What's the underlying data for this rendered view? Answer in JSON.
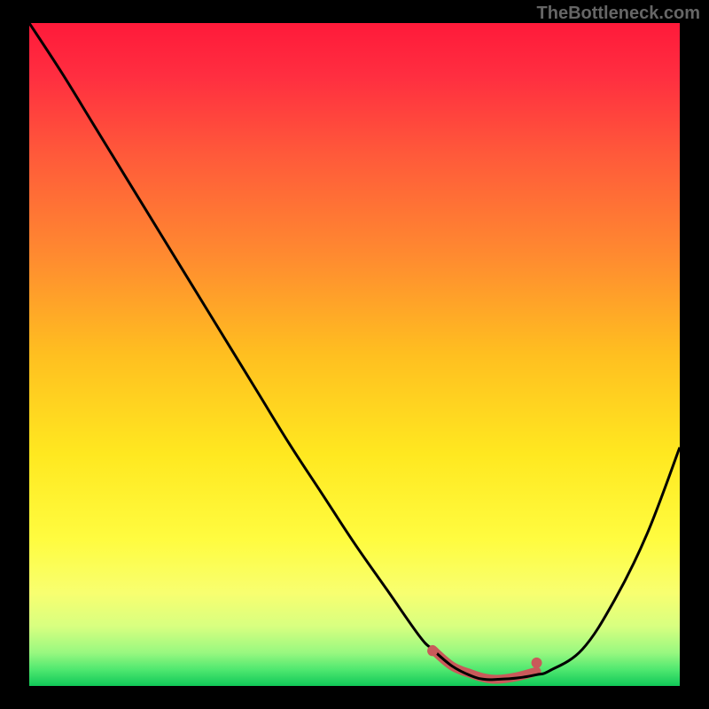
{
  "watermark": "TheBottleneck.com",
  "chart_data": {
    "type": "line",
    "title": "",
    "xlabel": "",
    "ylabel": "",
    "xlim": [
      0,
      100
    ],
    "ylim": [
      0,
      100
    ],
    "grid": false,
    "series": [
      {
        "name": "curve",
        "x": [
          0,
          5,
          10,
          15,
          20,
          25,
          30,
          35,
          40,
          45,
          50,
          55,
          60,
          62,
          65,
          68,
          70,
          72,
          75,
          78,
          80,
          85,
          90,
          95,
          100
        ],
        "y": [
          100,
          92.5,
          84.5,
          76.5,
          68.5,
          60.5,
          52.5,
          44.5,
          36.5,
          29,
          21.5,
          14.5,
          7.5,
          5.5,
          3.0,
          1.5,
          1.0,
          1.0,
          1.2,
          1.7,
          2.3,
          5.5,
          13,
          23,
          36
        ],
        "color": "#000000"
      }
    ],
    "markers": [
      {
        "x": 62,
        "y": 5.3,
        "color": "#c95a5a",
        "size": 6
      },
      {
        "x": 78,
        "y": 3.5,
        "color": "#c95a5a",
        "size": 6
      }
    ],
    "segment_overlay": {
      "x": [
        62,
        65,
        68,
        70,
        72,
        75,
        78
      ],
      "y": [
        5.5,
        3.0,
        1.8,
        1.2,
        1.0,
        1.4,
        2.2
      ],
      "color": "#c95a5a",
      "width": 10
    },
    "background_gradient": {
      "type": "vertical",
      "stops": [
        {
          "pos": 0.0,
          "color": "#ff1a3a"
        },
        {
          "pos": 0.08,
          "color": "#ff2e40"
        },
        {
          "pos": 0.2,
          "color": "#ff5a3a"
        },
        {
          "pos": 0.35,
          "color": "#ff8a30"
        },
        {
          "pos": 0.5,
          "color": "#ffbf20"
        },
        {
          "pos": 0.65,
          "color": "#ffe820"
        },
        {
          "pos": 0.78,
          "color": "#fffc40"
        },
        {
          "pos": 0.86,
          "color": "#f8ff70"
        },
        {
          "pos": 0.91,
          "color": "#d8ff80"
        },
        {
          "pos": 0.95,
          "color": "#98f880"
        },
        {
          "pos": 0.975,
          "color": "#50e870"
        },
        {
          "pos": 1.0,
          "color": "#10c858"
        }
      ]
    }
  }
}
